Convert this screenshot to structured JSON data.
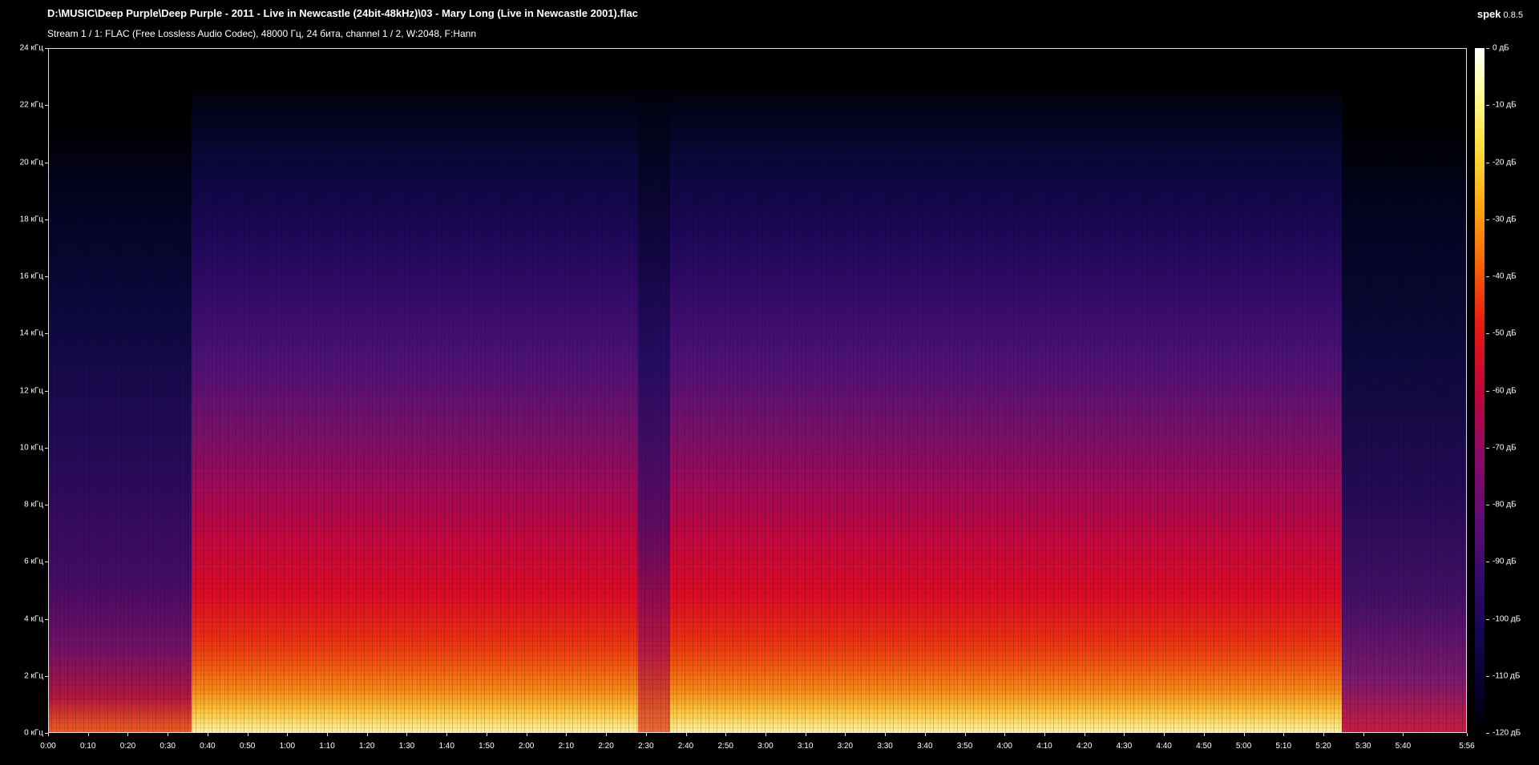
{
  "window": {
    "file_path": "D:\\MUSIC\\Deep Purple\\Deep Purple - 2011 - Live in Newcastle (24bit-48kHz)\\03 - Mary Long (Live in Newcastle 2001).flac",
    "stream_info": "Stream 1 / 1: FLAC (Free Lossless Audio Codec), 48000 Гц, 24 бита, channel 1 / 2, W:2048, F:Hann",
    "app_name": "spek",
    "app_version": "0.8.5"
  },
  "frequency_axis": {
    "unit": "кГц",
    "labels": [
      "24 кГц",
      "22 кГц",
      "20 кГц",
      "18 кГц",
      "16 кГц",
      "14 кГц",
      "12 кГц",
      "10 кГц",
      "8 кГц",
      "6 кГц",
      "4 кГц",
      "2 кГц",
      "0 кГц"
    ]
  },
  "time_axis": {
    "labels": [
      "0:00",
      "0:10",
      "0:20",
      "0:30",
      "0:40",
      "0:50",
      "1:00",
      "1:10",
      "1:20",
      "1:30",
      "1:40",
      "1:50",
      "2:00",
      "2:10",
      "2:20",
      "2:30",
      "2:40",
      "2:50",
      "3:00",
      "3:10",
      "3:20",
      "3:30",
      "3:40",
      "3:50",
      "4:00",
      "4:10",
      "4:20",
      "4:30",
      "4:40",
      "4:50",
      "5:00",
      "5:10",
      "5:20",
      "5:30",
      "5:40",
      "5:56"
    ],
    "duration_seconds": 356
  },
  "level_scale": {
    "unit": "дБ",
    "labels": [
      "0 дБ",
      "-10 дБ",
      "-20 дБ",
      "-30 дБ",
      "-40 дБ",
      "-50 дБ",
      "-60 дБ",
      "-70 дБ",
      "-80 дБ",
      "-90 дБ",
      "-100 дБ",
      "-110 дБ",
      "-120 дБ"
    ],
    "palette": [
      "#ffffff",
      "#ffe040",
      "#f86008",
      "#ea1a10",
      "#c0063a",
      "#8a0a68",
      "#5a0c78",
      "#140650",
      "#000000"
    ]
  }
}
